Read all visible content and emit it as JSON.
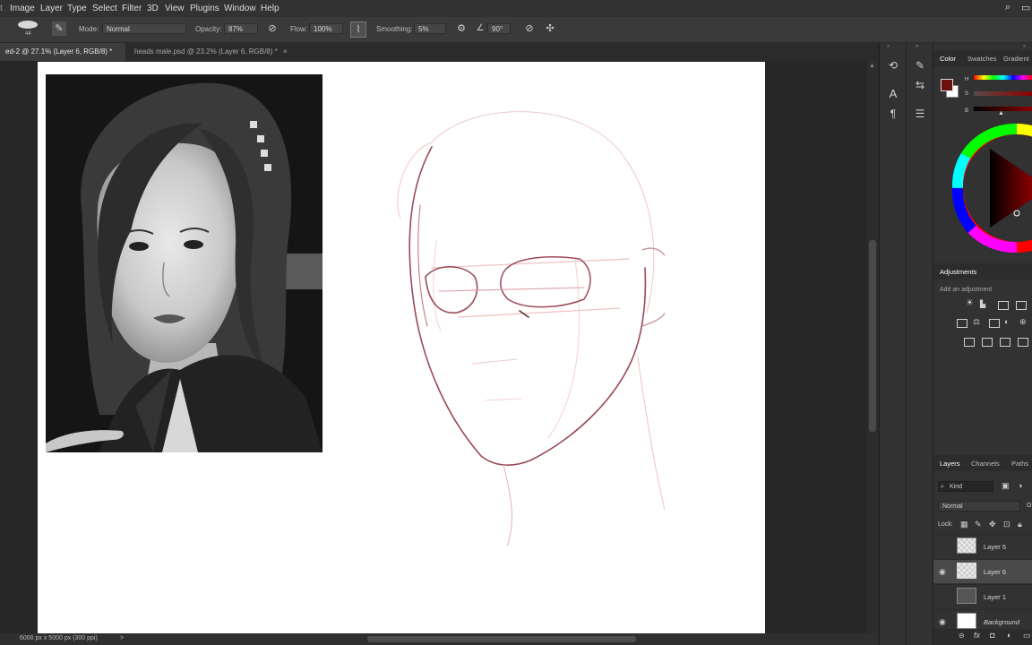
{
  "menu": [
    "Image",
    "Layer",
    "Type",
    "Select",
    "Filter",
    "3D",
    "View",
    "Plugins",
    "Window",
    "Help"
  ],
  "options": {
    "brush_size": "44",
    "mode_label": "Mode:",
    "mode_value": "Normal",
    "opacity_label": "Opacity:",
    "opacity_value": "87%",
    "flow_label": "Flow:",
    "flow_value": "100%",
    "smoothing_label": "Smoothing:",
    "smoothing_value": "5%",
    "angle_value": "90°"
  },
  "tabs": [
    {
      "label": "ed-2 @ 27.1% (Layer 6, RGB/8) *",
      "close": "×"
    },
    {
      "label": "heads male.psd @ 23.2% (Layer 6, RGB/8) *",
      "close": "×"
    }
  ],
  "status": {
    "doc_size": "6000 px x 5000 px (300 ppi)",
    "arrow": ">"
  },
  "color_panel": {
    "tabs": [
      "Color",
      "Swatches",
      "Gradient"
    ],
    "h_label": "H",
    "s_label": "S",
    "b_label": "B",
    "foreground": "#6b0f0f",
    "background": "#ffffff"
  },
  "adjustments": {
    "title": "Adjustments",
    "hint": "Add an adjustment"
  },
  "layers_panel": {
    "tabs": [
      "Layers",
      "Channels",
      "Paths"
    ],
    "filter_label": "Kind",
    "blend_mode": "Normal",
    "blend_extra": "O",
    "lock_label": "Lock:",
    "layers": [
      {
        "name": "Layer 5",
        "visible": false,
        "selected": false
      },
      {
        "name": "Layer 6",
        "visible": true,
        "selected": true
      },
      {
        "name": "Layer 1",
        "visible": false,
        "selected": false
      },
      {
        "name": "Background",
        "visible": true,
        "selected": false
      }
    ]
  }
}
